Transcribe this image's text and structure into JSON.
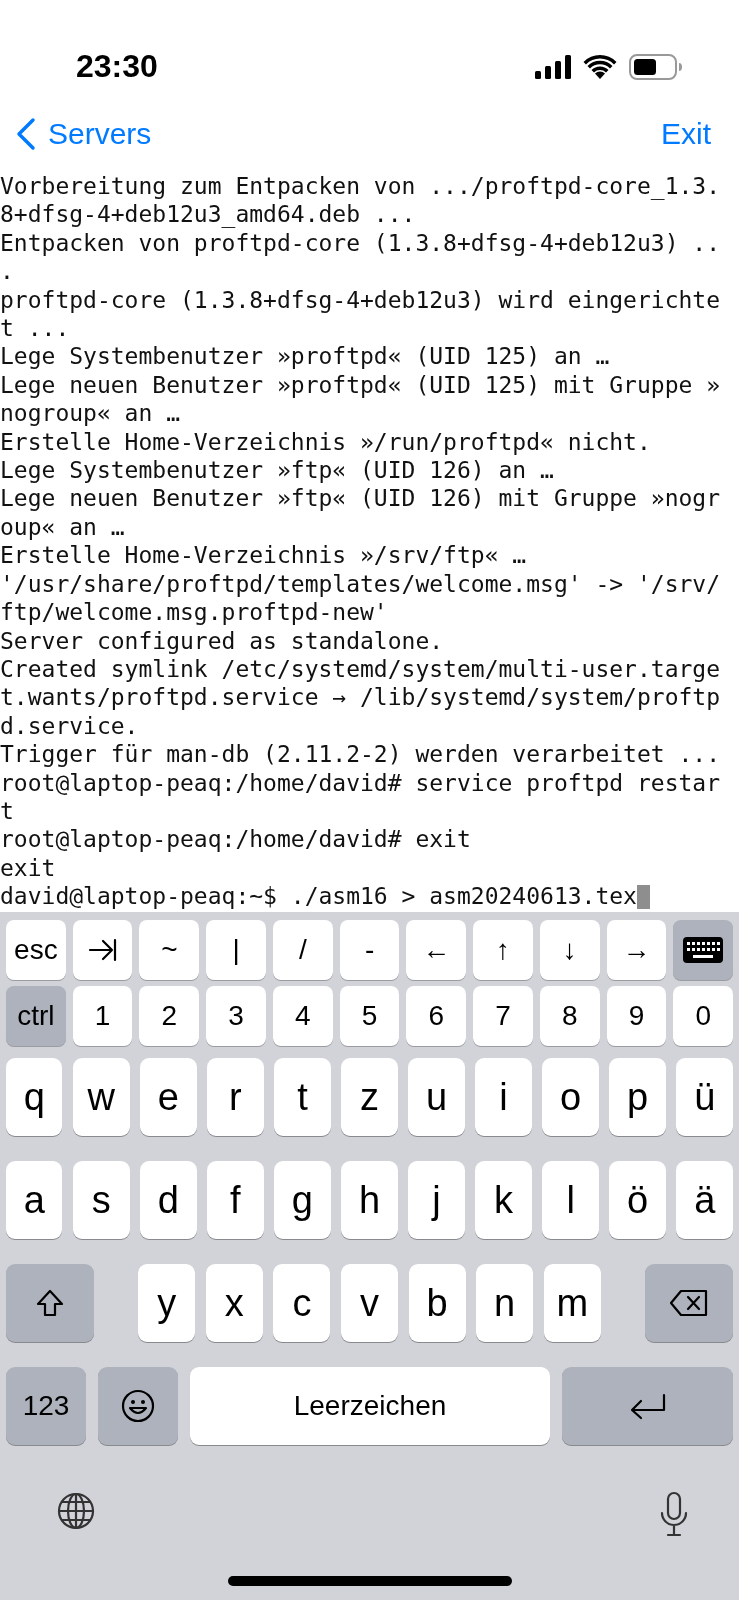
{
  "status_bar": {
    "time": "23:30"
  },
  "nav": {
    "back": "Servers",
    "action": "Exit"
  },
  "terminal": {
    "cursor_visible": true,
    "lines": [
      "Vorbereitung zum Entpacken von .../proftpd-core_1.3.",
      "8+dfsg-4+deb12u3_amd64.deb ...",
      "Entpacken von proftpd-core (1.3.8+dfsg-4+deb12u3) ..",
      ".",
      "proftpd-core (1.3.8+dfsg-4+deb12u3) wird eingerichte",
      "t ...",
      "Lege Systembenutzer »proftpd« (UID 125) an …",
      "Lege neuen Benutzer »proftpd« (UID 125) mit Gruppe »",
      "nogroup« an …",
      "Erstelle Home-Verzeichnis »/run/proftpd« nicht.",
      "Lege Systembenutzer »ftp« (UID 126) an …",
      "Lege neuen Benutzer »ftp« (UID 126) mit Gruppe »nogr",
      "oup« an …",
      "Erstelle Home-Verzeichnis »/srv/ftp« …",
      "'/usr/share/proftpd/templates/welcome.msg' -> '/srv/",
      "ftp/welcome.msg.proftpd-new'",
      "Server configured as standalone.",
      "Created symlink /etc/systemd/system/multi-user.targe",
      "t.wants/proftpd.service → /lib/systemd/system/proftp",
      "d.service.",
      "Trigger für man-db (2.11.2-2) werden verarbeitet ...",
      "root@laptop-peaq:/home/david# service proftpd restar",
      "t",
      "root@laptop-peaq:/home/david# exit",
      "exit",
      "david@laptop-peaq:~$ ./asm16 > asm20240613.tex"
    ]
  },
  "accessory_rows": [
    [
      {
        "kind": "key",
        "label": "esc"
      },
      {
        "kind": "tab"
      },
      {
        "kind": "key",
        "label": "~"
      },
      {
        "kind": "key",
        "label": "|"
      },
      {
        "kind": "key",
        "label": "/"
      },
      {
        "kind": "key",
        "label": "-"
      },
      {
        "kind": "key",
        "label": "←"
      },
      {
        "kind": "key",
        "label": "↑"
      },
      {
        "kind": "key",
        "label": "↓"
      },
      {
        "kind": "key",
        "label": "→"
      },
      {
        "kind": "keyboard"
      }
    ],
    [
      {
        "kind": "modifier",
        "label": "ctrl"
      },
      {
        "kind": "key",
        "label": "1"
      },
      {
        "kind": "key",
        "label": "2"
      },
      {
        "kind": "key",
        "label": "3"
      },
      {
        "kind": "key",
        "label": "4"
      },
      {
        "kind": "key",
        "label": "5"
      },
      {
        "kind": "key",
        "label": "6"
      },
      {
        "kind": "key",
        "label": "7"
      },
      {
        "kind": "key",
        "label": "8"
      },
      {
        "kind": "key",
        "label": "9"
      },
      {
        "kind": "key",
        "label": "0"
      }
    ]
  ],
  "letter_rows": [
    [
      "q",
      "w",
      "e",
      "r",
      "t",
      "z",
      "u",
      "i",
      "o",
      "p",
      "ü"
    ],
    [
      "a",
      "s",
      "d",
      "f",
      "g",
      "h",
      "j",
      "k",
      "l",
      "ö",
      "ä"
    ],
    [
      "y",
      "x",
      "c",
      "v",
      "b",
      "n",
      "m"
    ]
  ],
  "bottom_row": [
    {
      "kind": "numbers",
      "label": "123"
    },
    {
      "kind": "emoji"
    },
    {
      "kind": "space",
      "label": "Leerzeichen"
    },
    {
      "kind": "return"
    }
  ]
}
